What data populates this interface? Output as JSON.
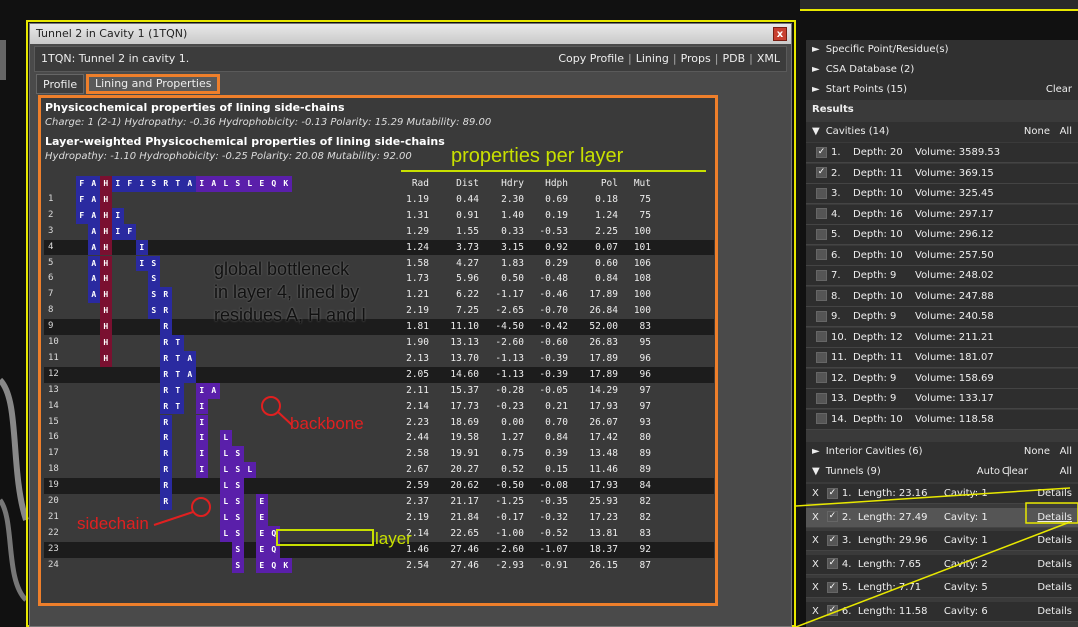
{
  "dialog": {
    "title": "Tunnel 2 in Cavity 1 (1TQN)",
    "close": "x",
    "header": "1TQN: Tunnel 2 in cavity 1.",
    "links": [
      "Copy Profile",
      "Lining",
      "Props",
      "PDB",
      "XML"
    ],
    "tabs": [
      "Profile",
      "Lining and Properties"
    ]
  },
  "props": {
    "title1": "Physicochemical properties of lining side-chains",
    "line1": "Charge: 1 (2-1)   Hydropathy: -0.36   Hydrophobicity: -0.13   Polarity: 15.29   Mutability: 89.00",
    "title2": "Layer-weighted Physicochemical properties of lining side-chains",
    "line2": "Hydropathy: -1.10   Hydrophobicity: -0.25   Polarity: 20.08   Mutability: 92.00"
  },
  "residues": [
    "F",
    "A",
    "H",
    "I",
    "F",
    "I",
    "S",
    "R",
    "T",
    "A",
    "I",
    "A",
    "L",
    "S",
    "L",
    "E",
    "Q",
    "K"
  ],
  "columns": [
    "Rad",
    "Dist",
    "Hdry",
    "Hdph",
    "Pol",
    "Mut"
  ],
  "layers": [
    {
      "n": "1",
      "res": "F A H",
      "rad": "1.19",
      "dist": "0.44",
      "hdry": "2.30",
      "hdph": "0.69",
      "pol": "0.18",
      "mut": "75"
    },
    {
      "n": "2",
      "res": "F A H I",
      "rad": "1.31",
      "dist": "0.91",
      "hdry": "1.40",
      "hdph": "0.19",
      "pol": "1.24",
      "mut": "75"
    },
    {
      "n": "3",
      "res": "A H I F",
      "rad": "1.29",
      "dist": "1.55",
      "hdry": "0.33",
      "hdph": "-0.53",
      "pol": "2.25",
      "mut": "100"
    },
    {
      "n": "4",
      "res": "A H I",
      "rad": "1.24",
      "dist": "3.73",
      "hdry": "3.15",
      "hdph": "0.92",
      "pol": "0.07",
      "mut": "101"
    },
    {
      "n": "5",
      "res": "A H I S",
      "rad": "1.58",
      "dist": "4.27",
      "hdry": "1.83",
      "hdph": "0.29",
      "pol": "0.60",
      "mut": "106"
    },
    {
      "n": "6",
      "res": "A H S",
      "rad": "1.73",
      "dist": "5.96",
      "hdry": "0.50",
      "hdph": "-0.48",
      "pol": "0.84",
      "mut": "108"
    },
    {
      "n": "7",
      "res": "A H S R",
      "rad": "1.21",
      "dist": "6.22",
      "hdry": "-1.17",
      "hdph": "-0.46",
      "pol": "17.89",
      "mut": "100"
    },
    {
      "n": "8",
      "res": "H S R",
      "rad": "2.19",
      "dist": "7.25",
      "hdry": "-2.65",
      "hdph": "-0.70",
      "pol": "26.84",
      "mut": "100"
    },
    {
      "n": "9",
      "res": "H R",
      "rad": "1.81",
      "dist": "11.10",
      "hdry": "-4.50",
      "hdph": "-0.42",
      "pol": "52.00",
      "mut": "83"
    },
    {
      "n": "10",
      "res": "H R T",
      "rad": "1.90",
      "dist": "13.13",
      "hdry": "-2.60",
      "hdph": "-0.60",
      "pol": "26.83",
      "mut": "95"
    },
    {
      "n": "11",
      "res": "H R T A",
      "rad": "2.13",
      "dist": "13.70",
      "hdry": "-1.13",
      "hdph": "-0.39",
      "pol": "17.89",
      "mut": "96"
    },
    {
      "n": "12",
      "res": "R T A",
      "rad": "2.05",
      "dist": "14.60",
      "hdry": "-1.13",
      "hdph": "-0.39",
      "pol": "17.89",
      "mut": "96"
    },
    {
      "n": "13",
      "res": "R T I A",
      "rad": "2.11",
      "dist": "15.37",
      "hdry": "-0.28",
      "hdph": "-0.05",
      "pol": "14.29",
      "mut": "97"
    },
    {
      "n": "14",
      "res": "R T I",
      "rad": "2.14",
      "dist": "17.73",
      "hdry": "-0.23",
      "hdph": "0.21",
      "pol": "17.93",
      "mut": "97"
    },
    {
      "n": "15",
      "res": "R I",
      "rad": "2.23",
      "dist": "18.69",
      "hdry": "0.00",
      "hdph": "0.70",
      "pol": "26.07",
      "mut": "93"
    },
    {
      "n": "16",
      "res": "R I L",
      "rad": "2.44",
      "dist": "19.58",
      "hdry": "1.27",
      "hdph": "0.84",
      "pol": "17.42",
      "mut": "80"
    },
    {
      "n": "17",
      "res": "R I L S",
      "rad": "2.58",
      "dist": "19.91",
      "hdry": "0.75",
      "hdph": "0.39",
      "pol": "13.48",
      "mut": "89"
    },
    {
      "n": "18",
      "res": "R I L S L",
      "rad": "2.67",
      "dist": "20.27",
      "hdry": "0.52",
      "hdph": "0.15",
      "pol": "11.46",
      "mut": "89"
    },
    {
      "n": "19",
      "res": "R L S",
      "rad": "2.59",
      "dist": "20.62",
      "hdry": "-0.50",
      "hdph": "-0.08",
      "pol": "17.93",
      "mut": "84"
    },
    {
      "n": "20",
      "res": "R L S E",
      "rad": "2.37",
      "dist": "21.17",
      "hdry": "-1.25",
      "hdph": "-0.35",
      "pol": "25.93",
      "mut": "82"
    },
    {
      "n": "21",
      "res": "L S E",
      "rad": "2.19",
      "dist": "21.84",
      "hdry": "-0.17",
      "hdph": "-0.32",
      "pol": "17.23",
      "mut": "82"
    },
    {
      "n": "22",
      "res": "L S E Q",
      "rad": "2.14",
      "dist": "22.65",
      "hdry": "-1.00",
      "hdph": "-0.52",
      "pol": "13.81",
      "mut": "83"
    },
    {
      "n": "23",
      "res": "S E Q",
      "rad": "1.46",
      "dist": "27.46",
      "hdry": "-2.60",
      "hdph": "-1.07",
      "pol": "18.37",
      "mut": "92"
    },
    {
      "n": "24",
      "res": "S E Q K",
      "rad": "2.54",
      "dist": "27.46",
      "hdry": "-2.93",
      "hdph": "-0.91",
      "pol": "26.15",
      "mut": "87"
    }
  ],
  "annotations": {
    "properties": "properties per layer",
    "bottleneck1": "global bottleneck",
    "bottleneck2": "in layer 4, lined by",
    "bottleneck3": "residues A, H and I",
    "backbone": "backbone",
    "sidechain": "sidechain",
    "layer": "layer"
  },
  "right": {
    "specific": "Specific Point/Residue(s)",
    "csa": "CSA Database (2)",
    "start": "Start Points (15)",
    "clear": "Clear",
    "results": "Results",
    "cavities": "Cavities (14)",
    "none": "None",
    "all": "All",
    "cavity_list": [
      {
        "n": "1.",
        "depth": "Depth: 20",
        "vol": "Volume: 3589.53",
        "checked": "✓"
      },
      {
        "n": "2.",
        "depth": "Depth: 11",
        "vol": "Volume: 369.15",
        "checked": "✓"
      },
      {
        "n": "3.",
        "depth": "Depth: 10",
        "vol": "Volume: 325.45",
        "checked": ""
      },
      {
        "n": "4.",
        "depth": "Depth: 16",
        "vol": "Volume: 297.17",
        "checked": ""
      },
      {
        "n": "5.",
        "depth": "Depth: 10",
        "vol": "Volume: 296.12",
        "checked": ""
      },
      {
        "n": "6.",
        "depth": "Depth: 10",
        "vol": "Volume: 257.50",
        "checked": ""
      },
      {
        "n": "7.",
        "depth": "Depth: 9",
        "vol": "Volume: 248.02",
        "checked": ""
      },
      {
        "n": "8.",
        "depth": "Depth: 10",
        "vol": "Volume: 247.88",
        "checked": ""
      },
      {
        "n": "9.",
        "depth": "Depth: 9",
        "vol": "Volume: 240.58",
        "checked": ""
      },
      {
        "n": "10.",
        "depth": "Depth: 12",
        "vol": "Volume: 211.21",
        "checked": ""
      },
      {
        "n": "11.",
        "depth": "Depth: 11",
        "vol": "Volume: 181.07",
        "checked": ""
      },
      {
        "n": "12.",
        "depth": "Depth: 9",
        "vol": "Volume: 158.69",
        "checked": ""
      },
      {
        "n": "13.",
        "depth": "Depth: 9",
        "vol": "Volume: 133.17",
        "checked": ""
      },
      {
        "n": "14.",
        "depth": "Depth: 10",
        "vol": "Volume: 118.58",
        "checked": ""
      }
    ],
    "interior": "Interior Cavities (6)",
    "tunnels": "Tunnels (9)",
    "auto": "Auto",
    "tunnel_list": [
      {
        "n": "1.",
        "len": "Length: 23.16",
        "cav": "Cavity: 1",
        "details": "Details"
      },
      {
        "n": "2.",
        "len": "Length: 27.49",
        "cav": "Cavity: 1",
        "details": "Details"
      },
      {
        "n": "3.",
        "len": "Length: 29.96",
        "cav": "Cavity: 1",
        "details": "Details"
      },
      {
        "n": "4.",
        "len": "Length: 7.65",
        "cav": "Cavity: 2",
        "details": "Details"
      },
      {
        "n": "5.",
        "len": "Length: 7.71",
        "cav": "Cavity: 5",
        "details": "Details"
      },
      {
        "n": "6.",
        "len": "Length: 11.58",
        "cav": "Cavity: 6",
        "details": "Details"
      }
    ],
    "x": "X",
    "check": "✓"
  },
  "colors": {
    "orange": "#ee7f2b",
    "yellow": "#e8e800",
    "red": "#e02020",
    "maroon": "#7a1030",
    "blue": "#2a2aa0",
    "violet": "#5a1faa"
  }
}
